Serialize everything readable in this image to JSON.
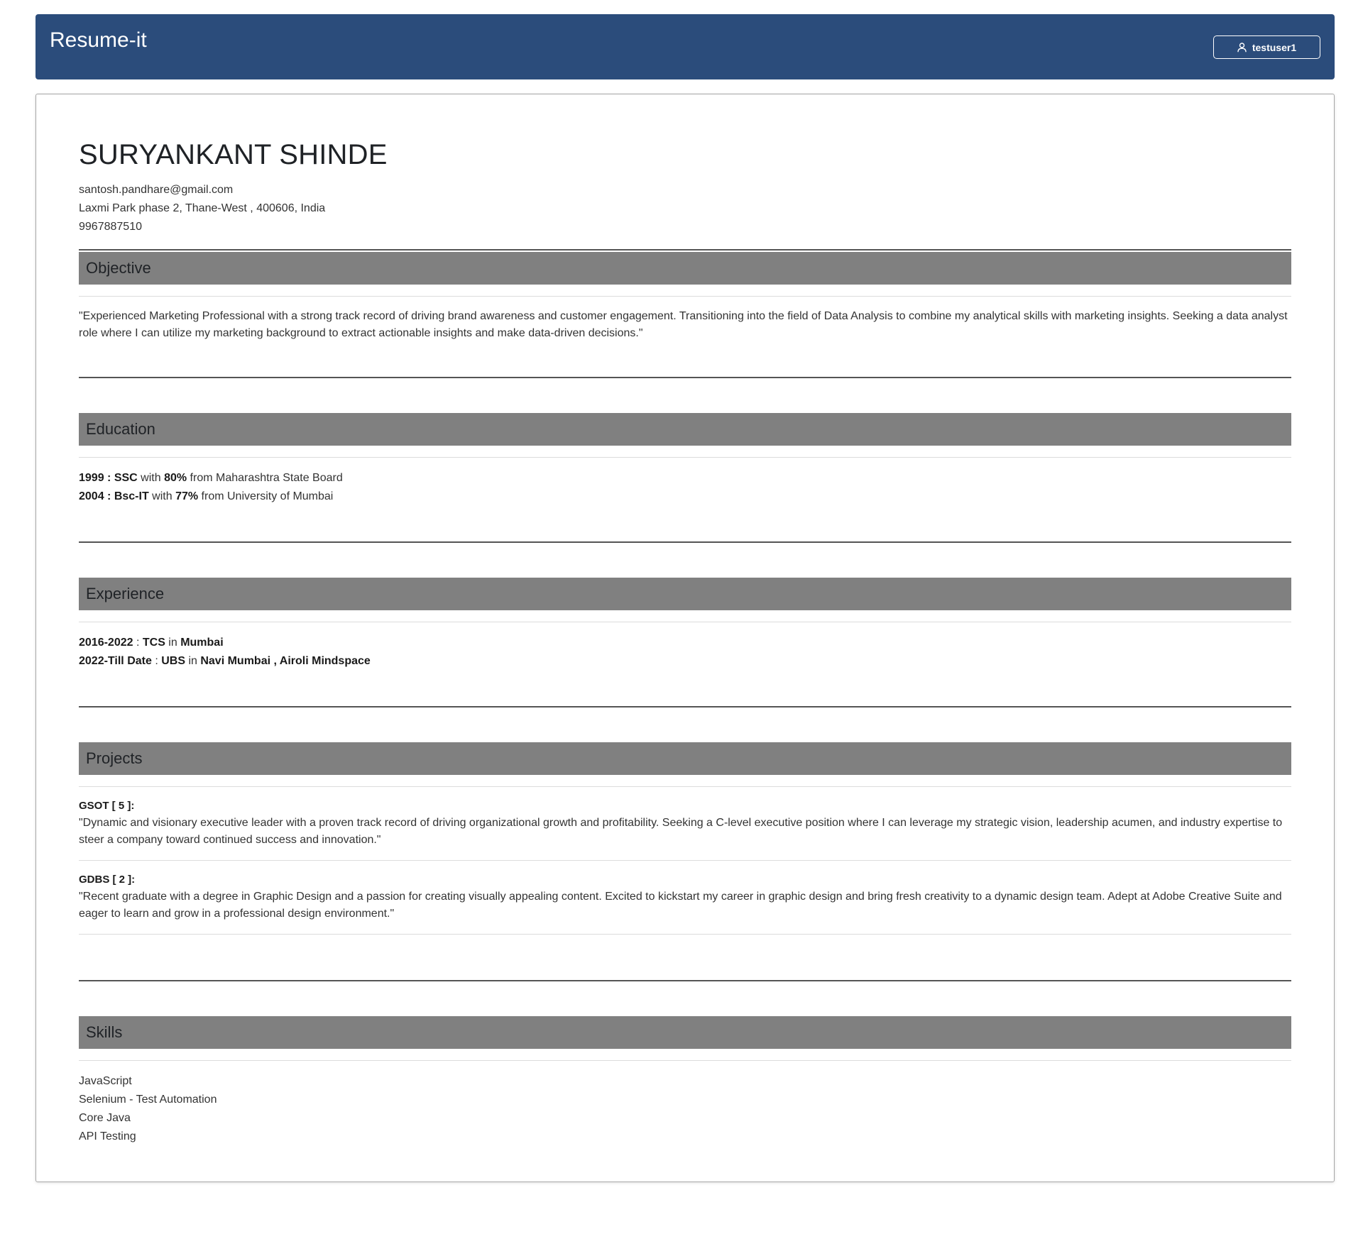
{
  "navbar": {
    "brand": "Resume-it",
    "username": "testuser1"
  },
  "resume": {
    "name": "SURYANKANT SHINDE",
    "email": "santosh.pandhare@gmail.com",
    "address": "Laxmi Park phase 2, Thane-West , 400606, India",
    "phone": "9967887510",
    "objective": {
      "heading": "Objective",
      "text": "\"Experienced Marketing Professional with a strong track record of driving brand awareness and customer engagement. Transitioning into the field of Data Analysis to combine my analytical skills with marketing insights. Seeking a data analyst role where I can utilize my marketing background to extract actionable insights and make data-driven decisions.\""
    },
    "education": {
      "heading": "Education",
      "items": [
        {
          "year": "1999",
          "sep": " : ",
          "degree": "SSC",
          "with": " with ",
          "score": "80%",
          "from": " from ",
          "institute": "Maharashtra State Board"
        },
        {
          "year": "2004",
          "sep": " : ",
          "degree": "Bsc-IT",
          "with": " with ",
          "score": "77%",
          "from": " from ",
          "institute": "University of Mumbai"
        }
      ]
    },
    "experience": {
      "heading": "Experience",
      "items": [
        {
          "period": "2016-2022",
          "sep": " : ",
          "company": "TCS",
          "in": " in ",
          "location": "Mumbai"
        },
        {
          "period": "2022-Till Date",
          "sep": " : ",
          "company": "UBS",
          "in": " in ",
          "location": "Navi Mumbai , Airoli Mindspace"
        }
      ]
    },
    "projects": {
      "heading": "Projects",
      "items": [
        {
          "title": "GSOT [ 5 ]:",
          "description": "\"Dynamic and visionary executive leader with a proven track record of driving organizational growth and profitability. Seeking a C-level executive position where I can leverage my strategic vision, leadership acumen, and industry expertise to steer a company toward continued success and innovation.\""
        },
        {
          "title": "GDBS [ 2 ]:",
          "description": "\"Recent graduate with a degree in Graphic Design and a passion for creating visually appealing content. Excited to kickstart my career in graphic design and bring fresh creativity to a dynamic design team. Adept at Adobe Creative Suite and eager to learn and grow in a professional design environment.\""
        }
      ]
    },
    "skills": {
      "heading": "Skills",
      "items": [
        "JavaScript",
        "Selenium - Test Automation",
        "Core Java",
        "API Testing"
      ]
    }
  },
  "colors": {
    "navbar_bg": "#2b4c7b",
    "section_header_bg": "#808080",
    "text": "#333333"
  },
  "icons": {
    "user": "user-icon"
  }
}
